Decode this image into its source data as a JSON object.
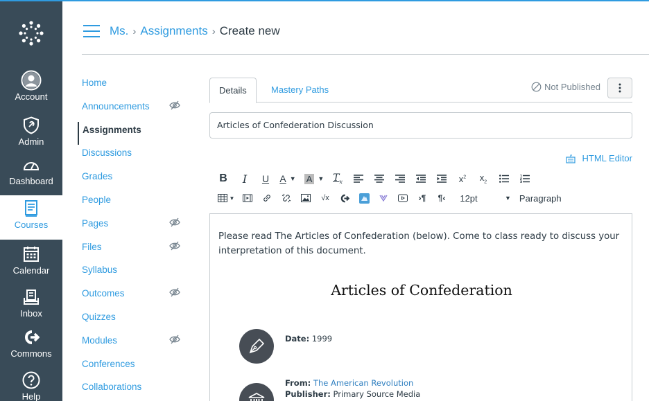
{
  "global_nav": {
    "items": [
      {
        "label": "Account",
        "icon": "avatar-icon"
      },
      {
        "label": "Admin",
        "icon": "admin-shield-icon"
      },
      {
        "label": "Dashboard",
        "icon": "dashboard-gauge-icon"
      },
      {
        "label": "Courses",
        "icon": "courses-book-icon",
        "active": true
      },
      {
        "label": "Calendar",
        "icon": "calendar-icon"
      },
      {
        "label": "Inbox",
        "icon": "inbox-icon"
      },
      {
        "label": "Commons",
        "icon": "commons-icon"
      },
      {
        "label": "Help",
        "icon": "help-icon"
      }
    ]
  },
  "breadcrumbs": {
    "course": "Ms.",
    "section": "Assignments",
    "current": "Create new"
  },
  "course_nav": {
    "items": [
      {
        "label": "Home",
        "hidden": false
      },
      {
        "label": "Announcements",
        "hidden": true
      },
      {
        "label": "Assignments",
        "hidden": false,
        "active": true
      },
      {
        "label": "Discussions",
        "hidden": false
      },
      {
        "label": "Grades",
        "hidden": false
      },
      {
        "label": "People",
        "hidden": false
      },
      {
        "label": "Pages",
        "hidden": true
      },
      {
        "label": "Files",
        "hidden": true
      },
      {
        "label": "Syllabus",
        "hidden": false
      },
      {
        "label": "Outcomes",
        "hidden": true
      },
      {
        "label": "Quizzes",
        "hidden": false
      },
      {
        "label": "Modules",
        "hidden": true
      },
      {
        "label": "Conferences",
        "hidden": false
      },
      {
        "label": "Collaborations",
        "hidden": false
      }
    ]
  },
  "tabs": {
    "details": "Details",
    "mastery": "Mastery Paths"
  },
  "publish_status": "Not Published",
  "assignment_title": "Articles of Confederation Discussion",
  "html_editor_label": "HTML Editor",
  "toolbar": {
    "font_size": "12pt",
    "block_format": "Paragraph"
  },
  "editor": {
    "intro": "Please read The Articles of Confederation (below). Come to class ready to discuss your interpretation of this document.",
    "heading": "Articles of Confederation",
    "date_label": "Date:",
    "date_value": "1999",
    "from_label": "From:",
    "from_value": "The American Revolution",
    "publisher_label": "Publisher:",
    "publisher_value": "Primary Source Media"
  },
  "colors": {
    "nav_bg": "#394b58",
    "accent": "#2f9be0",
    "text": "#2d3b45"
  }
}
